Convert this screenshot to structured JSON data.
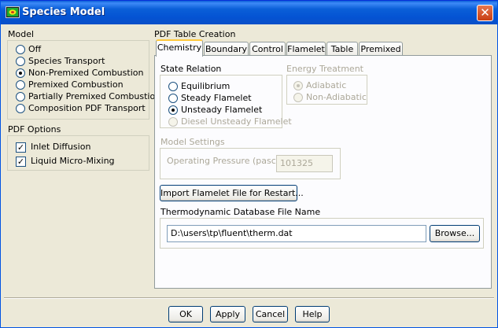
{
  "window": {
    "title": "Species Model",
    "close_symbol": "✕"
  },
  "model": {
    "heading": "Model",
    "options": [
      {
        "label": "Off",
        "selected": false
      },
      {
        "label": "Species Transport",
        "selected": false
      },
      {
        "label": "Non-Premixed Combustion",
        "selected": true
      },
      {
        "label": "Premixed Combustion",
        "selected": false
      },
      {
        "label": "Partially Premixed Combustion",
        "selected": false
      },
      {
        "label": "Composition PDF Transport",
        "selected": false
      }
    ]
  },
  "pdf_options": {
    "heading": "PDF Options",
    "items": [
      {
        "label": "Inlet Diffusion",
        "checked": true
      },
      {
        "label": "Liquid Micro-Mixing",
        "checked": true
      }
    ],
    "check_mark": "✓"
  },
  "pdf_table": {
    "heading": "PDF Table Creation",
    "tabs": [
      "Chemistry",
      "Boundary",
      "Control",
      "Flamelet",
      "Table",
      "Premixed"
    ],
    "active_tab": "Chemistry"
  },
  "chemistry": {
    "state_relation": {
      "heading": "State Relation",
      "options": [
        {
          "label": "Equilibrium",
          "selected": false,
          "enabled": true
        },
        {
          "label": "Steady Flamelet",
          "selected": false,
          "enabled": true
        },
        {
          "label": "Unsteady Flamelet",
          "selected": true,
          "enabled": true
        },
        {
          "label": "Diesel Unsteady Flamelet",
          "selected": false,
          "enabled": false
        }
      ]
    },
    "energy_treatment": {
      "heading": "Energy Treatment",
      "options": [
        {
          "label": "Adiabatic",
          "selected": true,
          "enabled": false
        },
        {
          "label": "Non-Adiabatic",
          "selected": false,
          "enabled": false
        }
      ]
    },
    "model_settings": {
      "heading": "Model Settings",
      "pressure_label": "Operating Pressure (pascal)",
      "pressure_value": "101325"
    },
    "import_button": "Import Flamelet File for Restart...",
    "thermo": {
      "heading": "Thermodynamic Database File Name",
      "path": "D:\\users\\tp\\fluent\\therm.dat",
      "browse_button": "Browse..."
    }
  },
  "footer": {
    "ok": "OK",
    "apply": "Apply",
    "cancel": "Cancel",
    "help": "Help"
  },
  "colors": {
    "titlebar": "#0a5fd8",
    "face": "#ece9d8",
    "tab_highlight": "#ffc83c"
  }
}
